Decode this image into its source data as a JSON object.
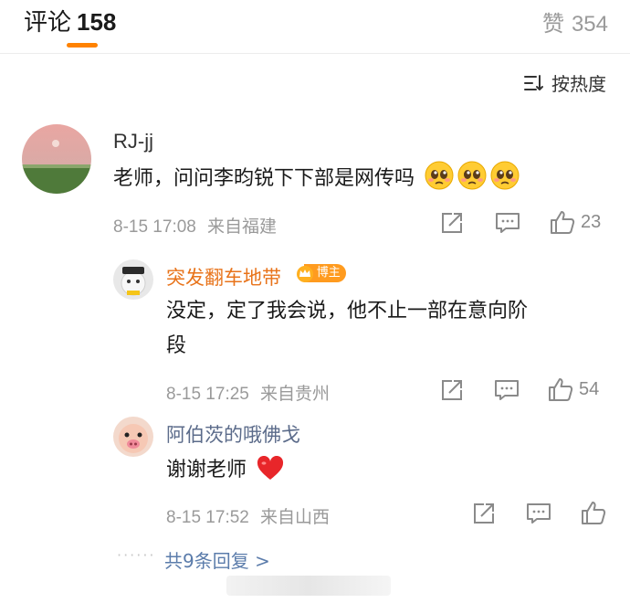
{
  "header": {
    "comments_label": "评论",
    "comments_count": "158",
    "likes_label": "赞",
    "likes_count": "354",
    "sort_label": "按热度"
  },
  "comments": [
    {
      "user": "RJ-jj",
      "text": "老师，问问李昀锐下下部是网传吗",
      "date": "8-15 17:08",
      "location": "来自福建",
      "likes": "23"
    }
  ],
  "replies": [
    {
      "user": "突发翻车地带",
      "badge": "博主",
      "text_line1": "没定，定了我会说，他不止一部在意向阶",
      "text_line2": "段",
      "date": "8-15 17:25",
      "location": "来自贵州",
      "likes": "54"
    },
    {
      "user": "阿伯茨的哦佛戈",
      "text": "谢谢老师",
      "date": "8-15 17:52",
      "location": "来自山西",
      "likes": ""
    }
  ],
  "more_replies": "共9条回复 >",
  "colors": {
    "accent": "#ff8200",
    "username": "#e8731a",
    "link": "#5b7cab",
    "meta": "#9a9a9a"
  },
  "icons": [
    "sort-icon",
    "share-icon",
    "comment-icon",
    "like-icon",
    "pleading-face-emoji",
    "heart-emoji",
    "crown-icon"
  ]
}
